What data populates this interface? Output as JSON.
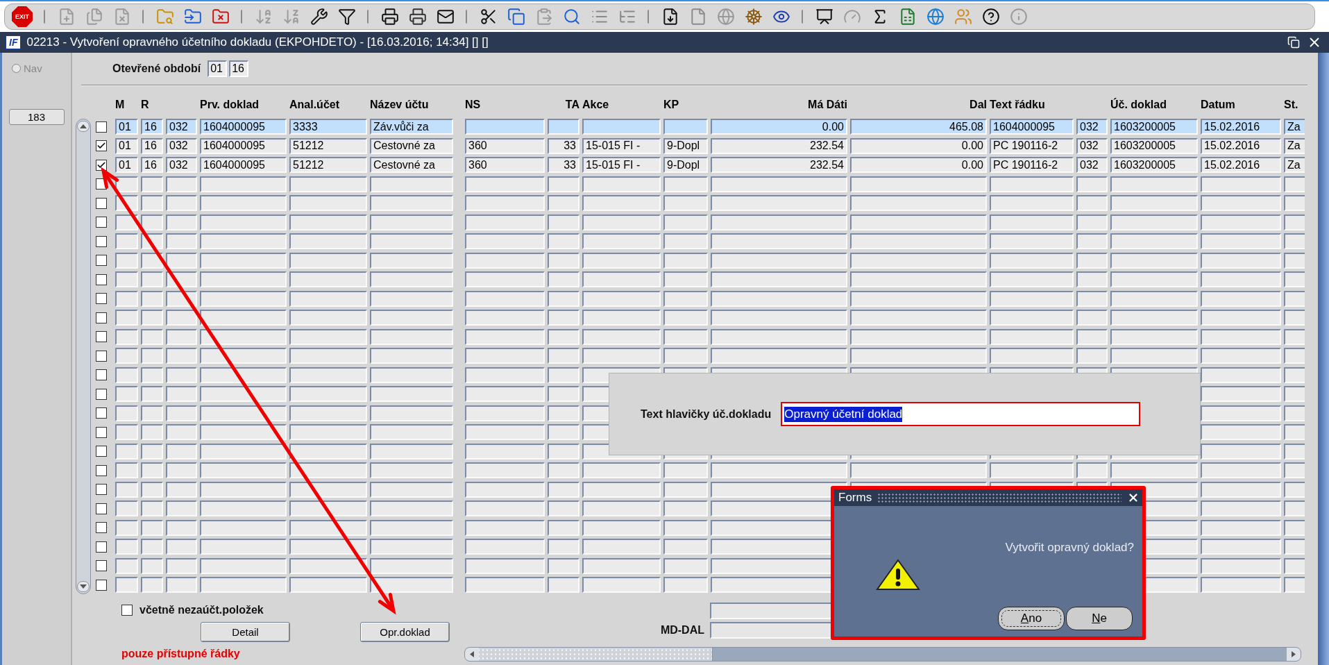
{
  "toolbar": {
    "exit_label": "EXIT"
  },
  "window": {
    "logo": "IF",
    "title": "02213 - Vytvoření opravného účetního dokladu (EKPOHDETO) - [16.03.2016; 14:34] [] []"
  },
  "sidebar": {
    "nav": {
      "label": "Nav",
      "selected": false
    },
    "record_count": "183"
  },
  "period": {
    "label": "Otevřené období",
    "month": "01",
    "year": "16"
  },
  "table": {
    "columns": [
      "M",
      "R",
      "Prv. doklad",
      "Anal.účet",
      "Název účtu",
      "NS",
      "TA",
      "Akce",
      "KP",
      "Má Dáti",
      "Dal",
      "Text řádku",
      "Úč. doklad",
      "Datum",
      "St."
    ],
    "rows": [
      {
        "checked": false,
        "selected": true,
        "cells": {
          "m": "01",
          "r": "16",
          "column_3": "032",
          "prv_doklad": "1604000095",
          "anal_ucet": "3333",
          "nazev_uctu": "Záv.vůči za",
          "ma_dati": "0.00",
          "dal": "465.08",
          "text_radku": "1604000095",
          "column_14": "032",
          "uc_doklad": "1603200005",
          "datum": "15.02.2016",
          "st": "Za"
        }
      },
      {
        "checked": true,
        "selected": false,
        "cells": {
          "m": "01",
          "r": "16",
          "column_3": "032",
          "prv_doklad": "1604000095",
          "anal_ucet": "51212",
          "nazev_uctu": "Cestovné za",
          "ns": "360",
          "ta": "33",
          "akce": "15-015 FI -",
          "kp": "9-Dopl",
          "ma_dati": "232.54",
          "dal": "0.00",
          "text_radku": "PC 190116-2",
          "column_14": "032",
          "uc_doklad": "1603200005",
          "datum": "15.02.2016",
          "st": "Za"
        }
      },
      {
        "checked": true,
        "selected": false,
        "cells": {
          "m": "01",
          "r": "16",
          "column_3": "032",
          "prv_doklad": "1604000095",
          "anal_ucet": "51212",
          "nazev_uctu": "Cestovné za",
          "ns": "360",
          "ta": "33",
          "akce": "15-015 FI -",
          "kp": "9-Dopl",
          "ma_dati": "232.54",
          "dal": "0.00",
          "text_radku": "PC 190116-2",
          "column_14": "032",
          "uc_doklad": "1603200005",
          "datum": "15.02.2016",
          "st": "Za"
        }
      },
      {
        "checked": false,
        "selected": false
      },
      {
        "checked": false,
        "selected": false
      },
      {
        "checked": false,
        "selected": false
      },
      {
        "checked": false,
        "selected": false
      },
      {
        "checked": false,
        "selected": false
      },
      {
        "checked": false,
        "selected": false
      },
      {
        "checked": false,
        "selected": false
      },
      {
        "checked": false,
        "selected": false
      },
      {
        "checked": false,
        "selected": false
      },
      {
        "checked": false,
        "selected": false
      },
      {
        "checked": false,
        "selected": false
      },
      {
        "checked": false,
        "selected": false
      },
      {
        "checked": false,
        "selected": false
      },
      {
        "checked": false,
        "selected": false
      },
      {
        "checked": false,
        "selected": false
      },
      {
        "checked": false,
        "selected": false
      },
      {
        "checked": false,
        "selected": false
      },
      {
        "checked": false,
        "selected": false
      },
      {
        "checked": false,
        "selected": false
      },
      {
        "checked": false,
        "selected": false
      },
      {
        "checked": false,
        "selected": false
      },
      {
        "checked": false,
        "selected": false
      }
    ]
  },
  "options": {
    "include_unposted": {
      "label": "včetně nezaúčt.položek",
      "checked": false
    }
  },
  "buttons": [
    {
      "label": "Detail"
    },
    {
      "label": "Opr.doklad"
    }
  ],
  "note": "pouze přístupné řádky",
  "totals": {
    "label": "MD-DAL"
  },
  "header_text_panel": {
    "label": "Text hlavičky úč.dokladu",
    "value": "Opravný účetní doklad",
    "text_selected": true
  },
  "dialog": {
    "title": "Forms",
    "message": "Vytvořit opravný doklad?",
    "buttons": [
      {
        "label": "Ano",
        "focused": true
      },
      {
        "label": "Ne",
        "focused": false
      }
    ]
  }
}
